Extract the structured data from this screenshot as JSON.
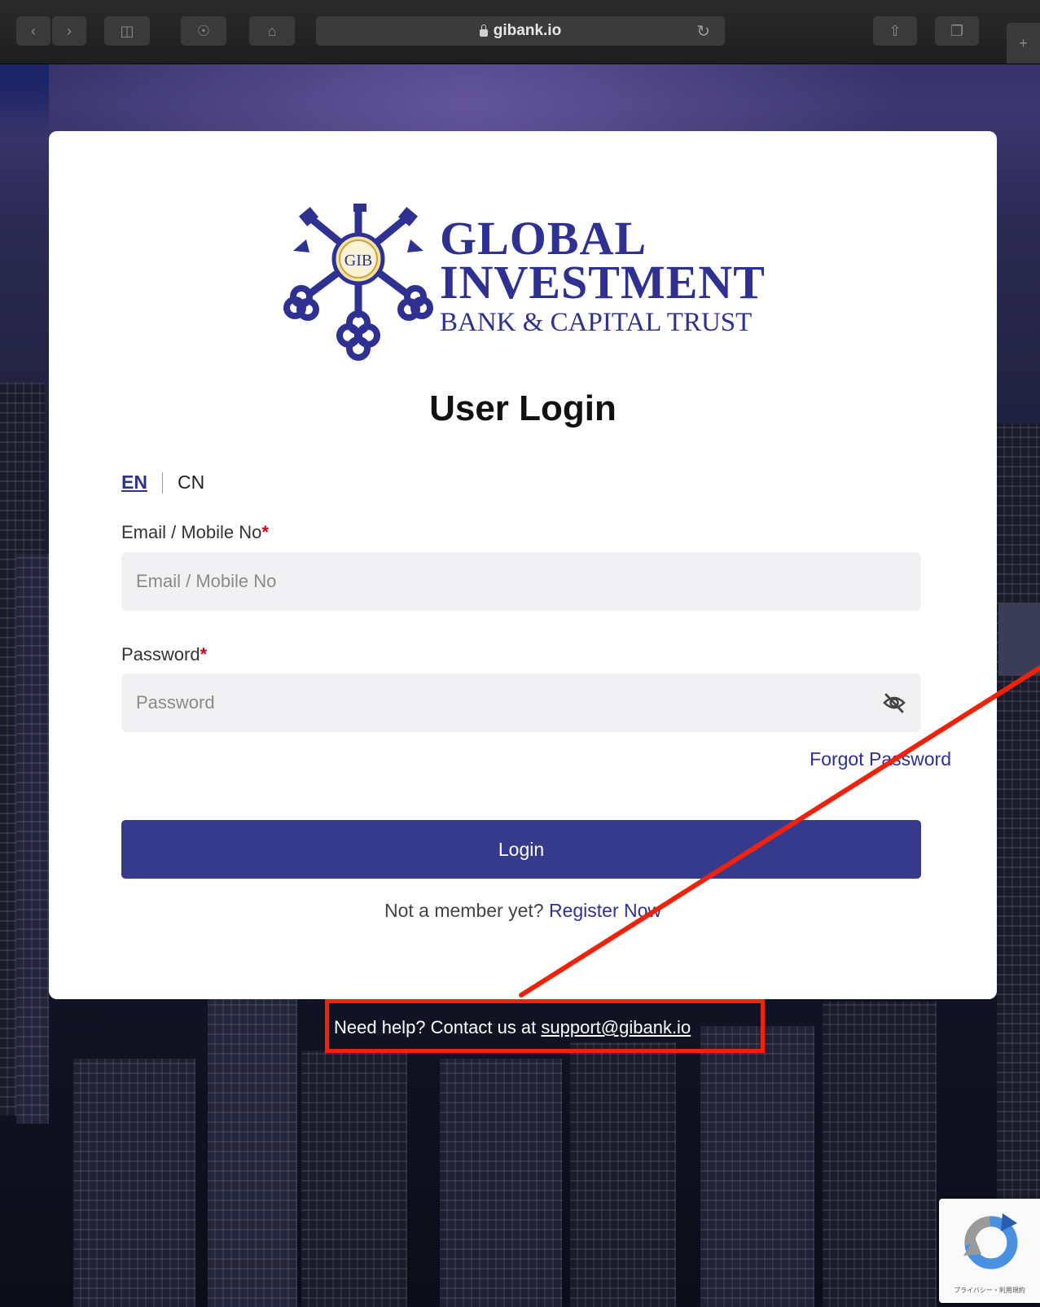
{
  "browser": {
    "url": "gibank.io"
  },
  "logo": {
    "monogram": "GIB",
    "line1": "GLOBAL",
    "line2": "INVESTMENT",
    "line3": "BANK & CAPITAL TRUST"
  },
  "page_title": "User Login",
  "language": {
    "options": [
      "EN",
      "CN"
    ],
    "selected": "EN"
  },
  "form": {
    "email": {
      "label": "Email / Mobile No",
      "required_mark": "*",
      "placeholder": "Email / Mobile No",
      "value": ""
    },
    "password": {
      "label": "Password",
      "required_mark": "*",
      "placeholder": "Password",
      "value": ""
    },
    "forgot_label": "Forgot Password",
    "login_label": "Login",
    "register_prompt": "Not a member yet?",
    "register_label": "Register Now"
  },
  "help": {
    "prefix": "Need help? Contact us at",
    "email": "support@gibank.io"
  },
  "recaptcha": {
    "footer": "プライバシー・利用規約"
  },
  "colors": {
    "brand": "#2e3192",
    "button": "#363a8c",
    "required": "#d0021b",
    "annotation": "#f0220a"
  }
}
